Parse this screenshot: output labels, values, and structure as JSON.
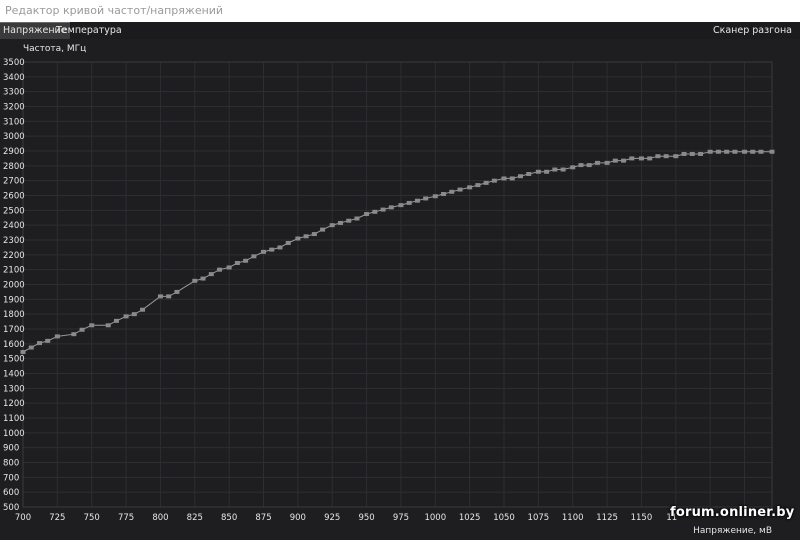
{
  "window": {
    "title": "Редактор кривой частот/напряжений"
  },
  "tabs": [
    {
      "label": "Напряжение",
      "active": true
    },
    {
      "label": "Температура",
      "active": false
    }
  ],
  "scanner_label": "Сканер разгона",
  "watermark": "forum.onliner.by",
  "colors": {
    "background": "#1e1e20",
    "plot_background": "#1e1e20",
    "grid": "#2e2e31",
    "curve": "#9a9a9a",
    "marker": "#8a8a8a",
    "text": "#e6e6e6"
  },
  "chart_data": {
    "type": "line",
    "title": "",
    "ylabel": "Частота, МГц",
    "xlabel": "Напряжение, мВ",
    "xlim": [
      700,
      1245
    ],
    "ylim": [
      500,
      3500
    ],
    "xticks": [
      700,
      725,
      750,
      775,
      800,
      825,
      850,
      875,
      900,
      925,
      950,
      975,
      1000,
      1025,
      1050,
      1075,
      1100,
      1125,
      1150
    ],
    "xtick_partial_label": "11",
    "yticks": [
      500,
      600,
      700,
      800,
      900,
      1000,
      1100,
      1200,
      1300,
      1400,
      1500,
      1600,
      1700,
      1800,
      1900,
      2000,
      2100,
      2200,
      2300,
      2400,
      2500,
      2600,
      2700,
      2800,
      2900,
      3000,
      3100,
      3200,
      3300,
      3400,
      3500
    ],
    "grid": true,
    "series": [
      {
        "x": [
          700,
          706,
          712,
          718,
          725,
          737,
          743,
          750,
          762,
          768,
          775,
          781,
          787,
          800,
          806,
          812,
          825,
          831,
          837,
          843,
          850,
          856,
          862,
          868,
          875,
          881,
          887,
          893,
          900,
          906,
          912,
          918,
          925,
          931,
          937,
          943,
          950,
          956,
          962,
          968,
          975,
          981,
          987,
          993,
          1000,
          1006,
          1012,
          1018,
          1025,
          1031,
          1037,
          1043,
          1050,
          1056,
          1062,
          1068,
          1075,
          1081,
          1087,
          1093,
          1100,
          1106,
          1112,
          1118,
          1125,
          1131,
          1137,
          1143,
          1150,
          1156,
          1162,
          1168,
          1175,
          1181,
          1187,
          1193,
          1200,
          1206,
          1212,
          1218,
          1225,
          1231,
          1237,
          1245
        ],
        "y": [
          1545,
          1575,
          1605,
          1620,
          1650,
          1665,
          1695,
          1725,
          1725,
          1755,
          1785,
          1800,
          1830,
          1920,
          1920,
          1950,
          2025,
          2040,
          2070,
          2100,
          2115,
          2145,
          2160,
          2190,
          2220,
          2235,
          2250,
          2280,
          2310,
          2325,
          2340,
          2370,
          2400,
          2415,
          2430,
          2445,
          2475,
          2490,
          2505,
          2520,
          2535,
          2550,
          2565,
          2580,
          2595,
          2610,
          2625,
          2640,
          2655,
          2670,
          2685,
          2700,
          2715,
          2715,
          2730,
          2745,
          2760,
          2760,
          2775,
          2775,
          2790,
          2805,
          2805,
          2820,
          2820,
          2835,
          2835,
          2850,
          2850,
          2850,
          2865,
          2865,
          2865,
          2880,
          2880,
          2880,
          2895,
          2895,
          2895,
          2895,
          2895,
          2895,
          2895,
          2895
        ]
      }
    ]
  }
}
